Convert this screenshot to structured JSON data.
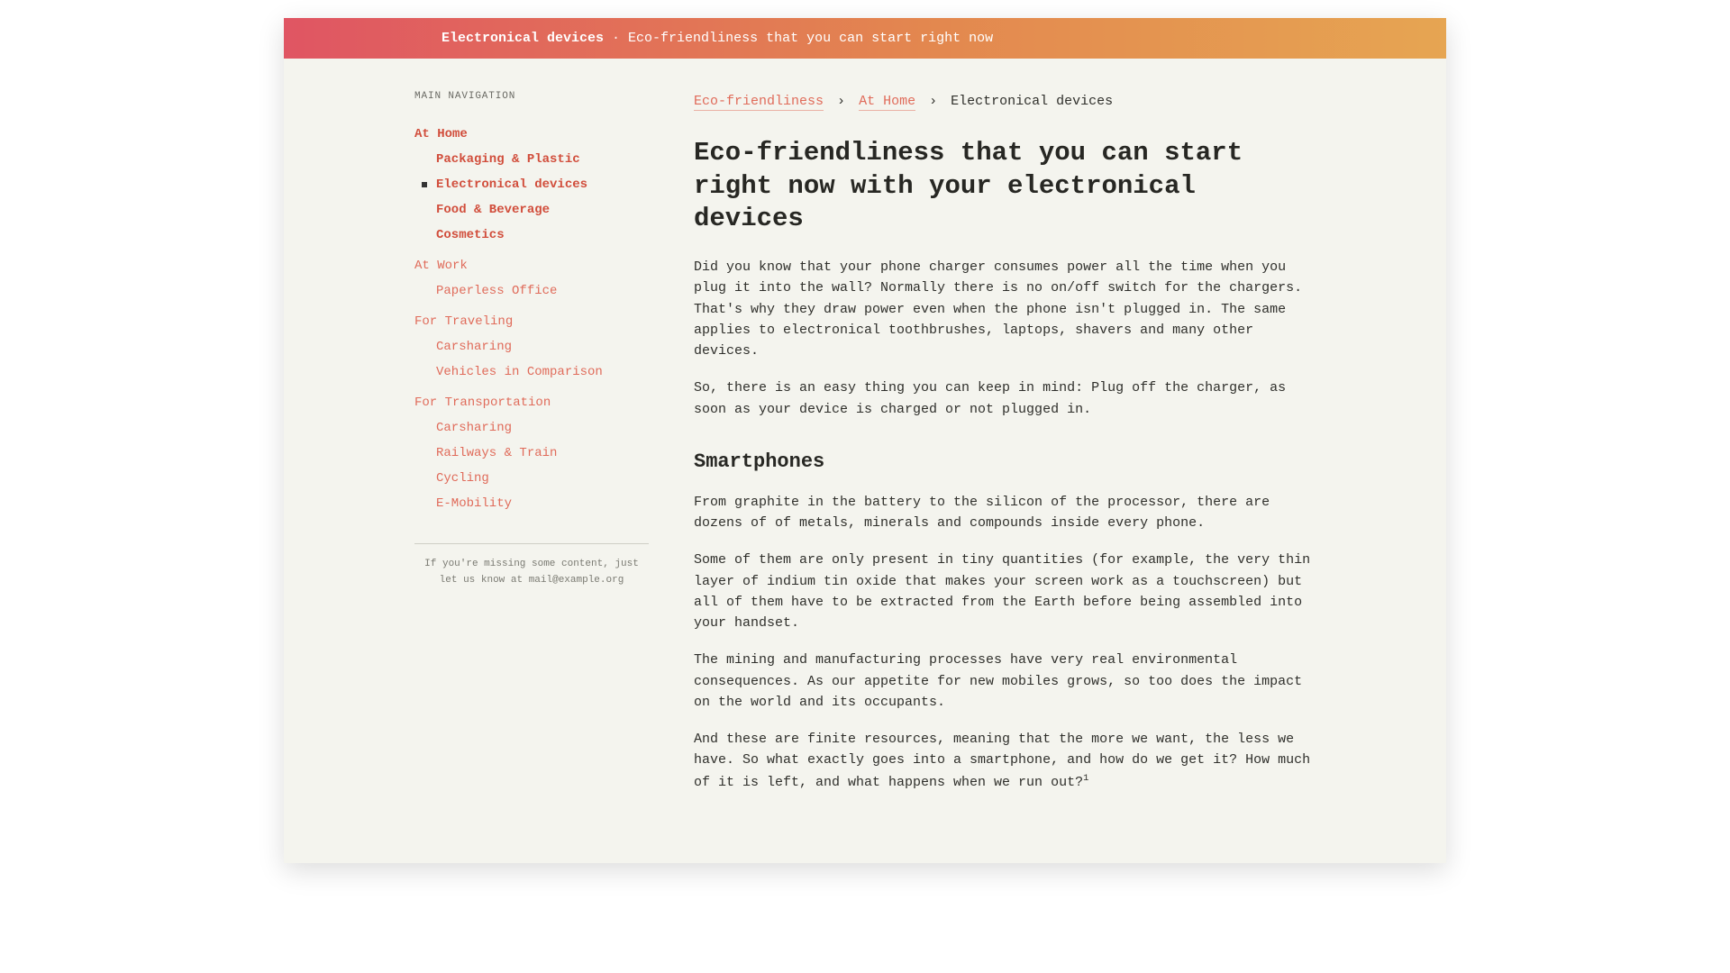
{
  "header": {
    "title": "Electronical devices",
    "separator": " · ",
    "subtitle": "Eco-friendliness that you can start right now"
  },
  "sidebar": {
    "heading": "MAIN NAVIGATION",
    "groups": [
      {
        "label": "At Home",
        "bold": true,
        "items": [
          {
            "label": "Packaging & Plastic",
            "bold": true,
            "active": false
          },
          {
            "label": "Electronical devices",
            "bold": true,
            "active": true
          },
          {
            "label": "Food & Beverage",
            "bold": true,
            "active": false
          },
          {
            "label": "Cosmetics",
            "bold": true,
            "active": false
          }
        ]
      },
      {
        "label": "At Work",
        "bold": false,
        "items": [
          {
            "label": "Paperless Office",
            "bold": false,
            "active": false
          }
        ]
      },
      {
        "label": "For Traveling",
        "bold": false,
        "items": [
          {
            "label": "Carsharing",
            "bold": false,
            "active": false
          },
          {
            "label": "Vehicles in Comparison",
            "bold": false,
            "active": false
          }
        ]
      },
      {
        "label": "For Transportation",
        "bold": false,
        "items": [
          {
            "label": "Carsharing",
            "bold": false,
            "active": false
          },
          {
            "label": "Railways & Train",
            "bold": false,
            "active": false
          },
          {
            "label": "Cycling",
            "bold": false,
            "active": false
          },
          {
            "label": "E-Mobility",
            "bold": false,
            "active": false
          }
        ]
      }
    ],
    "note": "If you're missing some content, just let us know at mail@example.org"
  },
  "breadcrumb": {
    "root": "Eco-friendliness",
    "parent": "At Home",
    "current": "Electronical devices",
    "sep": "›"
  },
  "article": {
    "h1": "Eco-friendliness that you can start right now with your electronical devices",
    "p1": "Did you know that your phone charger consumes power all the time when you plug it into the wall? Normally there is no on/off switch for the chargers. That's why they draw power even when the phone isn't plugged in. The same applies to electronical toothbrushes, laptops, shavers and many other devices.",
    "p2": "So, there is an easy thing you can keep in mind: Plug off the charger, as soon as your device is charged or not plugged in.",
    "h2": "Smartphones",
    "p3": "From graphite in the battery to the silicon of the processor, there are dozens of of metals, minerals and compounds inside every phone.",
    "p4": "Some of them are only present in tiny quantities (for example, the very thin layer of indium tin oxide that makes your screen work as a touchscreen) but all of them have to be extracted from the Earth before being assembled into your handset.",
    "p5": "The mining and manufacturing processes have very real environmental consequences. As our appetite for new mobiles grows, so too does the impact on the world and its occupants.",
    "p6": "And these are finite resources, meaning that the more we want, the less we have. So what exactly goes into a smartphone, and how do we get it? How much of it is left, and what happens when we run out?",
    "footnote_mark": "1"
  }
}
